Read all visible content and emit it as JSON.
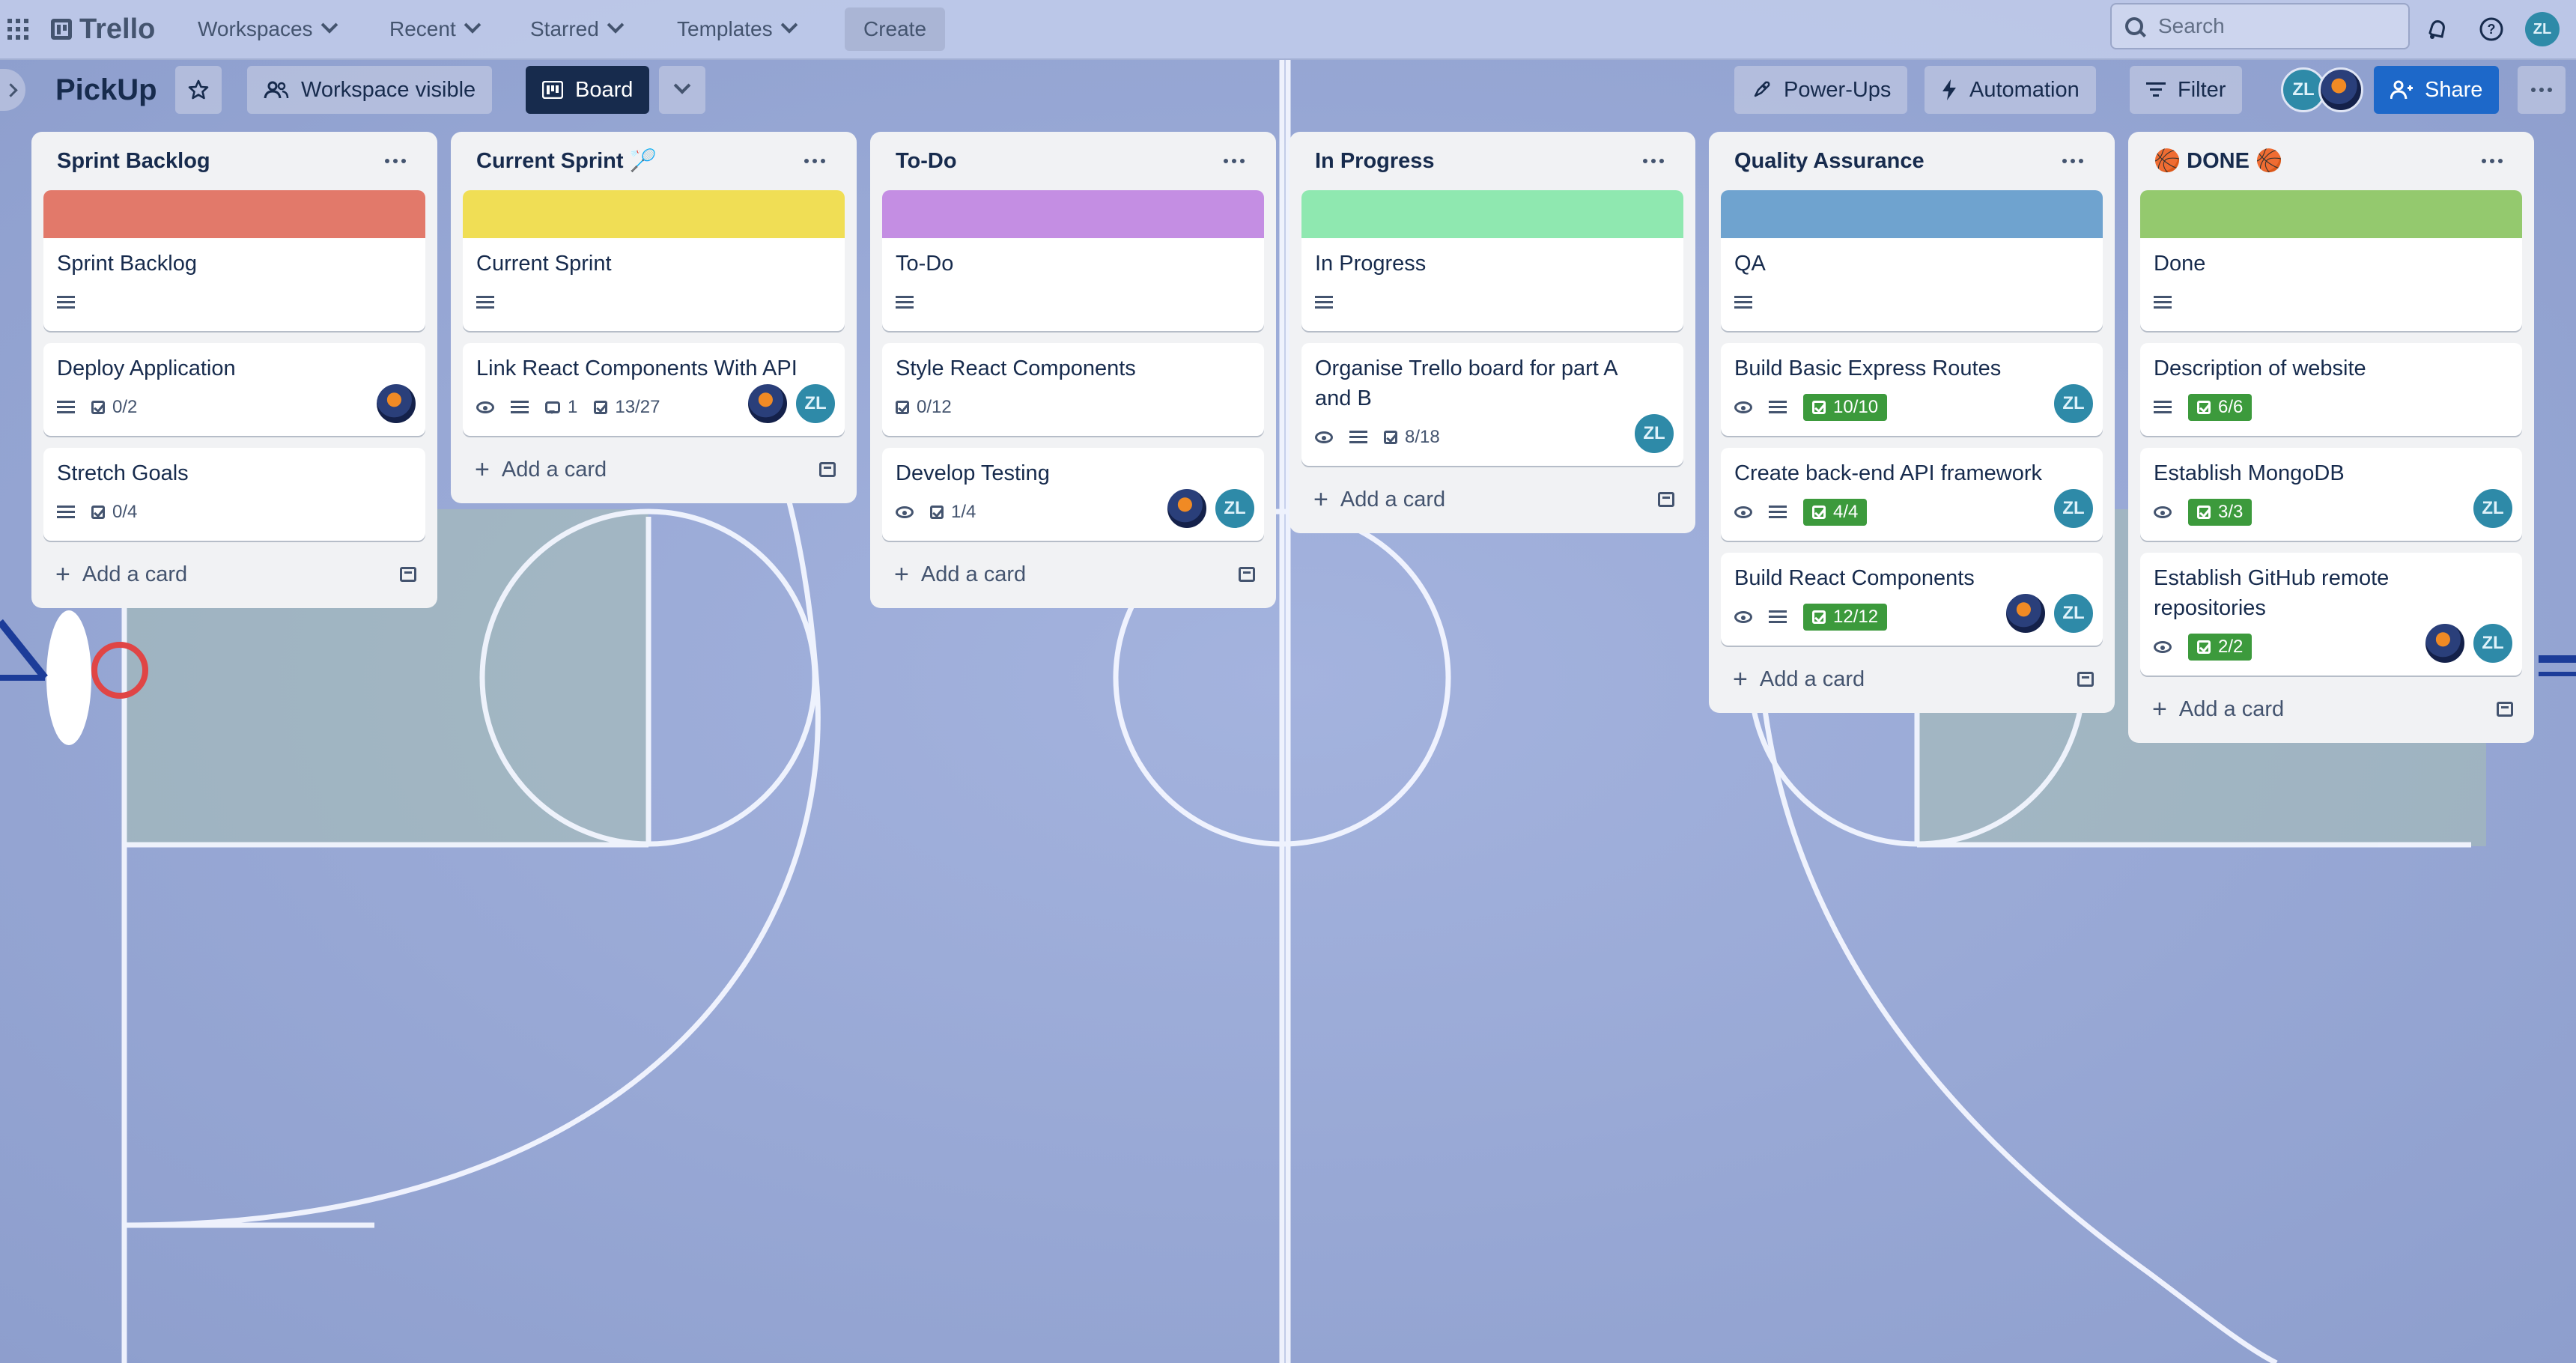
{
  "topbar": {
    "app_name": "Trello",
    "menus": [
      "Workspaces",
      "Recent",
      "Starred",
      "Templates"
    ],
    "create_label": "Create",
    "search_placeholder": "Search",
    "user_initials": "ZL"
  },
  "board": {
    "title": "PickUp",
    "visibility_label": "Workspace visible",
    "view_label": "Board",
    "powerups_label": "Power-Ups",
    "automation_label": "Automation",
    "filter_label": "Filter",
    "share_label": "Share",
    "member_initials": "ZL"
  },
  "add_card_label": "Add a card",
  "lists": [
    {
      "title": "Sprint Backlog",
      "cover_color": "#e2796a",
      "cards": [
        {
          "title": "Sprint Backlog",
          "badges": {
            "desc": true
          }
        },
        {
          "title": "Deploy Application",
          "badges": {
            "desc": true,
            "checklist": "0/2"
          },
          "members": [
            "photo"
          ]
        },
        {
          "title": "Stretch Goals",
          "badges": {
            "desc": true,
            "checklist": "0/4"
          }
        }
      ]
    },
    {
      "title": "Current Sprint 🏸",
      "cover_color": "#f0de55",
      "cards": [
        {
          "title": "Current Sprint",
          "badges": {
            "desc": true
          }
        },
        {
          "title": "Link React Components With API",
          "badges": {
            "watch": true,
            "desc": true,
            "comments": "1",
            "checklist": "13/27"
          },
          "members": [
            "photo",
            "ZL"
          ]
        }
      ]
    },
    {
      "title": "To-Do",
      "cover_color": "#c48ee3",
      "cards": [
        {
          "title": "To-Do",
          "badges": {
            "desc": true
          }
        },
        {
          "title": "Style React Components",
          "badges": {
            "checklist": "0/12"
          }
        },
        {
          "title": "Develop Testing",
          "badges": {
            "watch": true,
            "checklist": "1/4"
          },
          "members": [
            "photo",
            "ZL"
          ]
        }
      ]
    },
    {
      "title": "In Progress",
      "cover_color": "#8fe8b0",
      "cards": [
        {
          "title": "In Progress",
          "badges": {
            "desc": true
          }
        },
        {
          "title": "Organise Trello board for part A and B",
          "badges": {
            "watch": true,
            "desc": true,
            "checklist": "8/18"
          },
          "members": [
            "ZL"
          ]
        }
      ]
    },
    {
      "title": "Quality Assurance",
      "cover_color": "#6fa3cf",
      "cards": [
        {
          "title": "QA",
          "badges": {
            "desc": true
          }
        },
        {
          "title": "Build Basic Express Routes",
          "badges": {
            "watch": true,
            "desc": true,
            "checklist_done": "10/10"
          },
          "members": [
            "ZL"
          ]
        },
        {
          "title": "Create back-end API framework",
          "badges": {
            "watch": true,
            "desc": true,
            "checklist_done": "4/4"
          },
          "members": [
            "ZL"
          ]
        },
        {
          "title": "Build React Components",
          "badges": {
            "watch": true,
            "desc": true,
            "checklist_done": "12/12"
          },
          "members": [
            "photo",
            "ZL"
          ]
        }
      ]
    },
    {
      "title": "🏀 DONE 🏀",
      "cover_color": "#94c96e",
      "cards": [
        {
          "title": "Done",
          "badges": {
            "desc": true
          }
        },
        {
          "title": "Description of website",
          "badges": {
            "desc": true,
            "checklist_done": "6/6"
          }
        },
        {
          "title": "Establish MongoDB",
          "badges": {
            "watch": true,
            "checklist_done": "3/3"
          },
          "members": [
            "ZL"
          ]
        },
        {
          "title": "Establish GitHub remote repositories",
          "badges": {
            "watch": true,
            "checklist_done": "2/2"
          },
          "members": [
            "photo",
            "ZL"
          ]
        }
      ]
    }
  ],
  "colors": {
    "court_background": "#9aa9d6",
    "court_lines": "#f3f6ff",
    "board_button": "#172b4d",
    "share_button": "#1d68c9",
    "checklist_complete": "#3c9a3c",
    "avatar": "#2e8aa8"
  }
}
